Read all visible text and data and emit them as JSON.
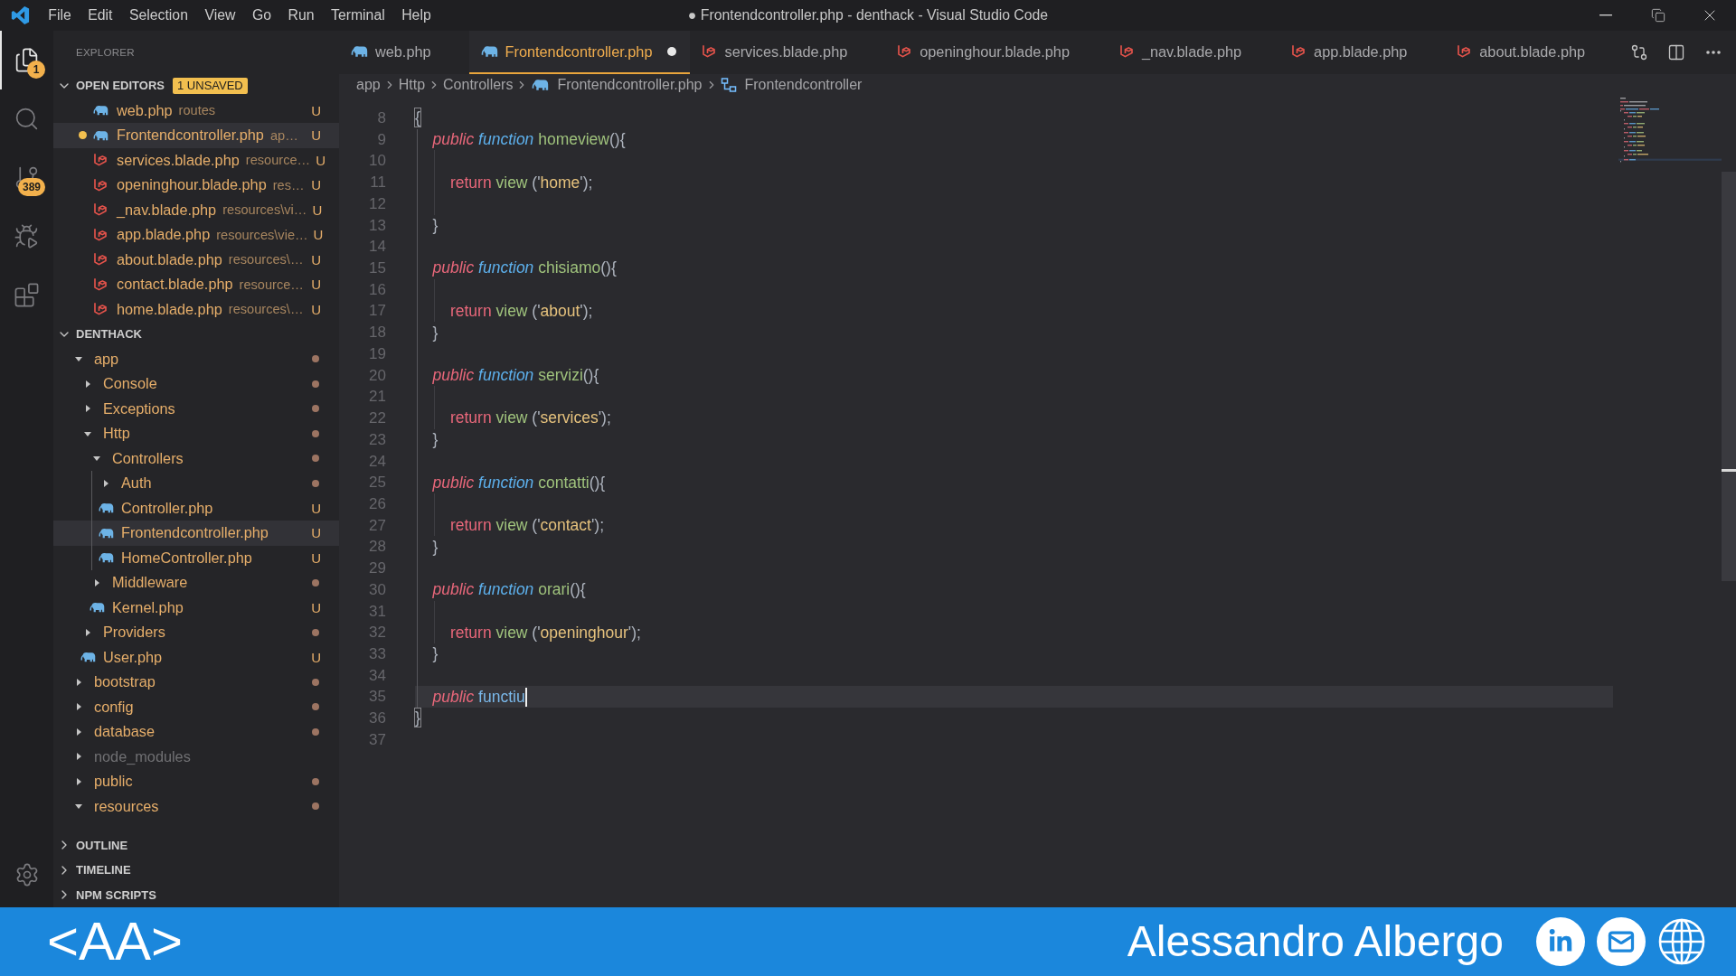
{
  "title_bar": {
    "menu": [
      "File",
      "Edit",
      "Selection",
      "View",
      "Go",
      "Run",
      "Terminal",
      "Help"
    ],
    "title": "● Frontendcontroller.php - denthack - Visual Studio Code"
  },
  "activity_bar": [
    {
      "kind": "explorer",
      "selected": true,
      "badge": "1"
    },
    {
      "kind": "search",
      "selected": false
    },
    {
      "kind": "source-control",
      "selected": false,
      "badge": "389"
    },
    {
      "kind": "run",
      "selected": false
    },
    {
      "kind": "extensions",
      "selected": false
    }
  ],
  "sidebar": {
    "title": "EXPLORER",
    "open_editors": {
      "title": "OPEN EDITORS",
      "expanded": true,
      "badge": "1 UNSAVED",
      "items": [
        {
          "name": "web.php",
          "description": "routes",
          "kind": "php",
          "status": "U",
          "dirty": false,
          "selected": false
        },
        {
          "name": "Frontendcontroller.php",
          "description": "ap…",
          "kind": "php",
          "status": "U",
          "dirty": true,
          "selected": true
        },
        {
          "name": "services.blade.php",
          "description": "resource…",
          "kind": "blade",
          "status": "U",
          "dirty": false,
          "selected": false
        },
        {
          "name": "openinghour.blade.php",
          "description": "res…",
          "kind": "blade",
          "status": "U",
          "dirty": false,
          "selected": false
        },
        {
          "name": "_nav.blade.php",
          "description": "resources\\vi…",
          "kind": "blade",
          "status": "U",
          "dirty": false,
          "selected": false
        },
        {
          "name": "app.blade.php",
          "description": "resources\\vie…",
          "kind": "blade",
          "status": "U",
          "dirty": false,
          "selected": false
        },
        {
          "name": "about.blade.php",
          "description": "resources\\…",
          "kind": "blade",
          "status": "U",
          "dirty": false,
          "selected": false
        },
        {
          "name": "contact.blade.php",
          "description": "resource…",
          "kind": "blade",
          "status": "U",
          "dirty": false,
          "selected": false
        },
        {
          "name": "home.blade.php",
          "description": "resources\\…",
          "kind": "blade",
          "status": "U",
          "dirty": false,
          "selected": false
        }
      ]
    },
    "project": {
      "title": "DENTHACK",
      "expanded": true,
      "tree": [
        {
          "name": "app",
          "kind": "folder",
          "expanded": true,
          "selected": false,
          "children": [
            {
              "name": "Console",
              "kind": "folder",
              "expanded": false,
              "selected": false
            },
            {
              "name": "Exceptions",
              "kind": "folder",
              "expanded": false,
              "selected": false
            },
            {
              "name": "Http",
              "kind": "folder",
              "expanded": true,
              "selected": false,
              "children": [
                {
                  "name": "Controllers",
                  "kind": "folder",
                  "expanded": true,
                  "selected": false,
                  "children": [
                    {
                      "name": "Auth",
                      "kind": "folder",
                      "expanded": false,
                      "selected": false
                    },
                    {
                      "name": "Controller.php",
                      "kind": "php",
                      "status": "U",
                      "selected": false
                    },
                    {
                      "name": "Frontendcontroller.php",
                      "kind": "php",
                      "status": "U",
                      "selected": true
                    },
                    {
                      "name": "HomeController.php",
                      "kind": "php",
                      "status": "U",
                      "selected": false
                    }
                  ]
                },
                {
                  "name": "Middleware",
                  "kind": "folder",
                  "expanded": false,
                  "selected": false
                },
                {
                  "name": "Kernel.php",
                  "kind": "php",
                  "status": "U",
                  "selected": false
                }
              ]
            },
            {
              "name": "Providers",
              "kind": "folder",
              "expanded": false,
              "selected": false
            },
            {
              "name": "User.php",
              "kind": "php",
              "status": "U",
              "selected": false
            }
          ]
        },
        {
          "name": "bootstrap",
          "kind": "folder",
          "expanded": false,
          "selected": false
        },
        {
          "name": "config",
          "kind": "folder",
          "expanded": false,
          "selected": false
        },
        {
          "name": "database",
          "kind": "folder",
          "expanded": false,
          "selected": false
        },
        {
          "name": "node_modules",
          "kind": "ignored-folder",
          "expanded": false,
          "selected": false
        },
        {
          "name": "public",
          "kind": "folder",
          "expanded": false,
          "selected": false
        },
        {
          "name": "resources",
          "kind": "folder",
          "expanded": true,
          "selected": false
        }
      ]
    },
    "panels": [
      {
        "title": "OUTLINE",
        "expanded": false
      },
      {
        "title": "TIMELINE",
        "expanded": false
      },
      {
        "title": "NPM SCRIPTS",
        "expanded": false
      }
    ]
  },
  "tabs": [
    {
      "label": "web.php",
      "kind": "php",
      "selected": false,
      "dirty": false
    },
    {
      "label": "Frontendcontroller.php",
      "kind": "php",
      "selected": true,
      "dirty": true
    },
    {
      "label": "services.blade.php",
      "kind": "blade",
      "selected": false,
      "dirty": false
    },
    {
      "label": "openinghour.blade.php",
      "kind": "blade",
      "selected": false,
      "dirty": false
    },
    {
      "label": "_nav.blade.php",
      "kind": "blade",
      "selected": false,
      "dirty": false
    },
    {
      "label": "app.blade.php",
      "kind": "blade",
      "selected": false,
      "dirty": false
    },
    {
      "label": "about.blade.php",
      "kind": "blade",
      "selected": false,
      "dirty": false
    }
  ],
  "breadcrumb": [
    {
      "label": "app",
      "kind": "folder"
    },
    {
      "label": "Http",
      "kind": "folder"
    },
    {
      "label": "Controllers",
      "kind": "folder"
    },
    {
      "label": "Frontendcontroller.php",
      "kind": "php"
    },
    {
      "label": "Frontendcontroller",
      "kind": "class"
    }
  ],
  "editor": {
    "lines": [
      {
        "number": "8",
        "active": false,
        "tokens": [
          {
            "kind": "bracket-match",
            "text": "{"
          }
        ]
      },
      {
        "number": "9",
        "active": false,
        "tokens": [
          {
            "kind": "modifier",
            "text": "    public"
          },
          {
            "kind": "storage",
            "text": " function"
          },
          {
            "kind": "entity",
            "text": " homeview"
          },
          {
            "kind": "punctuation",
            "text": "(){"
          }
        ]
      },
      {
        "number": "10",
        "active": false
      },
      {
        "number": "11",
        "active": false,
        "tokens": [
          {
            "kind": "control",
            "text": "        return"
          },
          {
            "kind": "call",
            "text": " view"
          },
          {
            "kind": "punctuation",
            "text": " ('"
          },
          {
            "kind": "string",
            "text": "home"
          },
          {
            "kind": "punctuation",
            "text": "');"
          }
        ]
      },
      {
        "number": "12",
        "active": false
      },
      {
        "number": "13",
        "active": false,
        "tokens": [
          {
            "kind": "punctuation",
            "text": "    }"
          }
        ]
      },
      {
        "number": "14",
        "active": false
      },
      {
        "number": "15",
        "active": false,
        "tokens": [
          {
            "kind": "modifier",
            "text": "    public"
          },
          {
            "kind": "storage",
            "text": " function"
          },
          {
            "kind": "entity",
            "text": " chisiamo"
          },
          {
            "kind": "punctuation",
            "text": "(){"
          }
        ]
      },
      {
        "number": "16",
        "active": false
      },
      {
        "number": "17",
        "active": false,
        "tokens": [
          {
            "kind": "control",
            "text": "        return"
          },
          {
            "kind": "call",
            "text": " view"
          },
          {
            "kind": "punctuation",
            "text": " ('"
          },
          {
            "kind": "string",
            "text": "about"
          },
          {
            "kind": "punctuation",
            "text": "');"
          }
        ]
      },
      {
        "number": "18",
        "active": false,
        "tokens": [
          {
            "kind": "punctuation",
            "text": "    }"
          }
        ]
      },
      {
        "number": "19",
        "active": false
      },
      {
        "number": "20",
        "active": false,
        "tokens": [
          {
            "kind": "modifier",
            "text": "    public"
          },
          {
            "kind": "storage",
            "text": " function"
          },
          {
            "kind": "entity",
            "text": " servizi"
          },
          {
            "kind": "punctuation",
            "text": "(){"
          }
        ]
      },
      {
        "number": "21",
        "active": false
      },
      {
        "number": "22",
        "active": false,
        "tokens": [
          {
            "kind": "control",
            "text": "        return"
          },
          {
            "kind": "call",
            "text": " view"
          },
          {
            "kind": "punctuation",
            "text": " ('"
          },
          {
            "kind": "string",
            "text": "services"
          },
          {
            "kind": "punctuation",
            "text": "');"
          }
        ]
      },
      {
        "number": "23",
        "active": false,
        "tokens": [
          {
            "kind": "punctuation",
            "text": "    }"
          }
        ]
      },
      {
        "number": "24",
        "active": false
      },
      {
        "number": "25",
        "active": false,
        "tokens": [
          {
            "kind": "modifier",
            "text": "    public"
          },
          {
            "kind": "storage",
            "text": " function"
          },
          {
            "kind": "entity",
            "text": " contatti"
          },
          {
            "kind": "punctuation",
            "text": "(){"
          }
        ]
      },
      {
        "number": "26",
        "active": false
      },
      {
        "number": "27",
        "active": false,
        "tokens": [
          {
            "kind": "control",
            "text": "        return"
          },
          {
            "kind": "call",
            "text": " view"
          },
          {
            "kind": "punctuation",
            "text": " ('"
          },
          {
            "kind": "string",
            "text": "contact"
          },
          {
            "kind": "punctuation",
            "text": "');"
          }
        ]
      },
      {
        "number": "28",
        "active": false,
        "tokens": [
          {
            "kind": "punctuation",
            "text": "    }"
          }
        ]
      },
      {
        "number": "29",
        "active": false
      },
      {
        "number": "30",
        "active": false,
        "tokens": [
          {
            "kind": "modifier",
            "text": "    public"
          },
          {
            "kind": "storage",
            "text": " function"
          },
          {
            "kind": "entity",
            "text": " orari"
          },
          {
            "kind": "punctuation",
            "text": "(){"
          }
        ]
      },
      {
        "number": "31",
        "active": false
      },
      {
        "number": "32",
        "active": false,
        "tokens": [
          {
            "kind": "control",
            "text": "        return"
          },
          {
            "kind": "call",
            "text": " view"
          },
          {
            "kind": "punctuation",
            "text": " ('"
          },
          {
            "kind": "string",
            "text": "openinghour"
          },
          {
            "kind": "punctuation",
            "text": "');"
          }
        ]
      },
      {
        "number": "33",
        "active": false,
        "tokens": [
          {
            "kind": "punctuation",
            "text": "    }"
          }
        ]
      },
      {
        "number": "34",
        "active": false
      },
      {
        "number": "35",
        "active": true,
        "tokens": [
          {
            "kind": "modifier",
            "text": "    public"
          },
          {
            "kind": "identifier",
            "text": " functiu"
          }
        ]
      },
      {
        "number": "36",
        "active": false,
        "tokens": [
          {
            "kind": "bracket-match",
            "text": "}"
          }
        ]
      },
      {
        "number": "37",
        "active": false
      }
    ]
  },
  "banner": {
    "logo": "<AA>",
    "name": "Alessandro Albergo"
  }
}
